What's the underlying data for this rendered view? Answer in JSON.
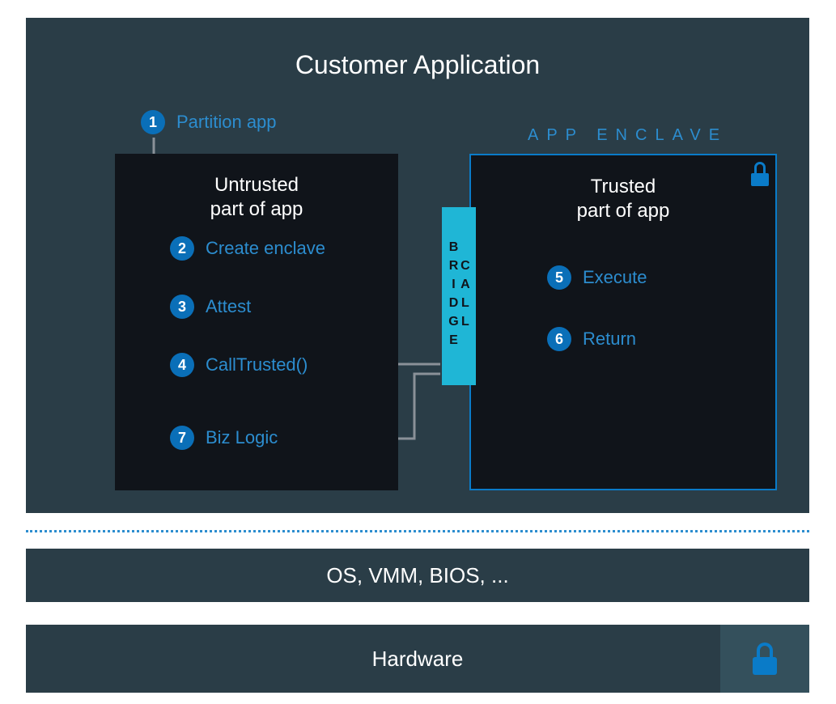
{
  "diagram": {
    "title": "Customer Application",
    "untrusted": {
      "title_l1": "Untrusted",
      "title_l2": "part of app"
    },
    "trusted": {
      "title_l1": "Trusted",
      "title_l2": "part of app"
    },
    "enclave_label": "APP ENCLAVE",
    "call_bridge": "CALL BRIDGE",
    "steps": {
      "s1": {
        "num": "1",
        "label": "Partition app"
      },
      "s2": {
        "num": "2",
        "label": "Create enclave"
      },
      "s3": {
        "num": "3",
        "label": "Attest"
      },
      "s4": {
        "num": "4",
        "label": "CallTrusted()"
      },
      "s5": {
        "num": "5",
        "label": "Execute"
      },
      "s6": {
        "num": "6",
        "label": "Return"
      },
      "s7": {
        "num": "7",
        "label": "Biz Logic"
      }
    }
  },
  "bars": {
    "os": "OS, VMM, BIOS, ...",
    "hw": "Hardware"
  },
  "icons": {
    "lock_enclave": "lock-icon",
    "lock_hardware": "lock-icon"
  }
}
